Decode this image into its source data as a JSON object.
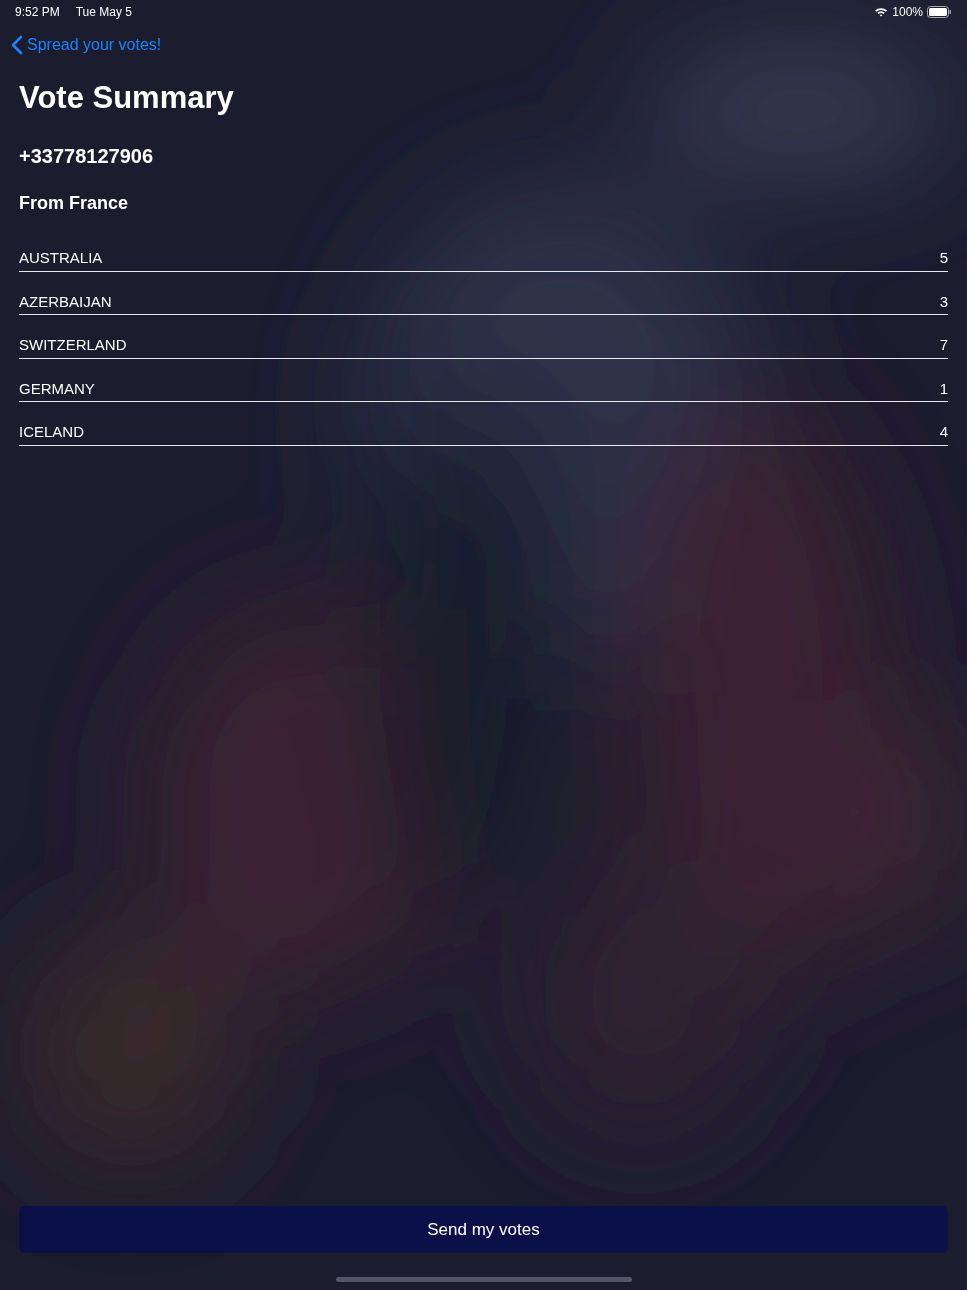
{
  "status_bar": {
    "time": "9:52 PM",
    "date": "Tue May 5",
    "battery": "100%"
  },
  "nav": {
    "back_label": "Spread your votes!"
  },
  "title": "Vote Summary",
  "phone": "+33778127906",
  "origin": "From France",
  "votes": [
    {
      "country": "AUSTRALIA",
      "points": "5"
    },
    {
      "country": "AZERBAIJAN",
      "points": "3"
    },
    {
      "country": "SWITZERLAND",
      "points": "7"
    },
    {
      "country": "GERMANY",
      "points": "1"
    },
    {
      "country": "ICELAND",
      "points": "4"
    }
  ],
  "send_button": "Send my votes"
}
